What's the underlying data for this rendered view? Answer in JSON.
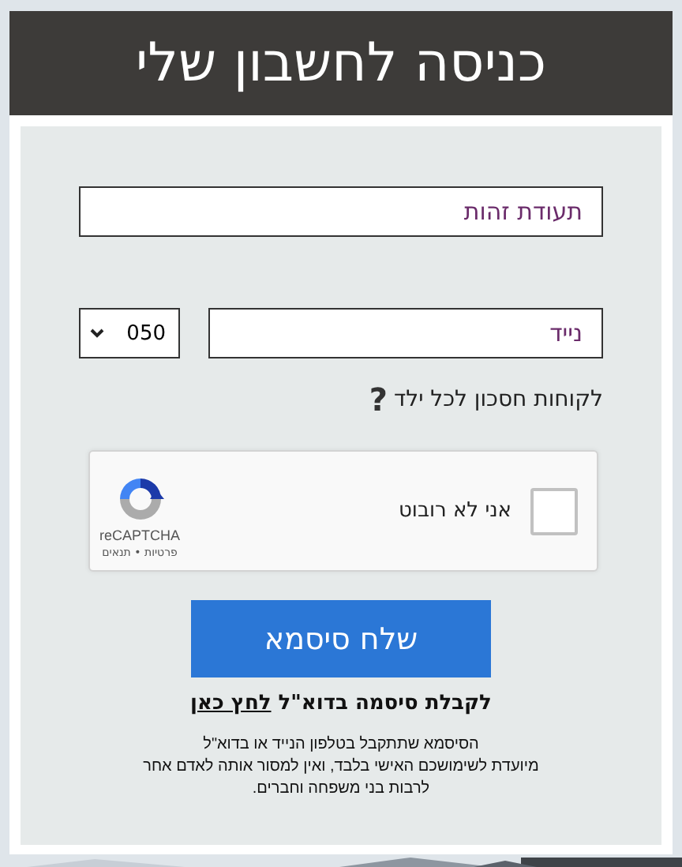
{
  "header": {
    "title": "כניסה לחשבון שלי"
  },
  "id_field": {
    "placeholder": "תעודת זהות"
  },
  "phone": {
    "placeholder": "נייד",
    "prefix": "050"
  },
  "child_savings_link": {
    "label": "לקוחות חסכון לכל ילד",
    "help": "?"
  },
  "captcha": {
    "label": "אני לא רובוט",
    "checked": false,
    "brand": "reCAPTCHA",
    "links": "פרטיות • תנאים"
  },
  "send_button": {
    "label": "שלח סיסמא"
  },
  "email_line": {
    "text": "לקבלת סיסמה בדוא\"ל",
    "link": "לחץ כאן"
  },
  "notice": "הסיסמא שתתקבל בטלפון הנייד או בדוא\"ל\nמיועדת לשימושכם האישי בלבד, ואין למסור אותה לאדם אחר\nלרבות בני משפחה וחברים."
}
